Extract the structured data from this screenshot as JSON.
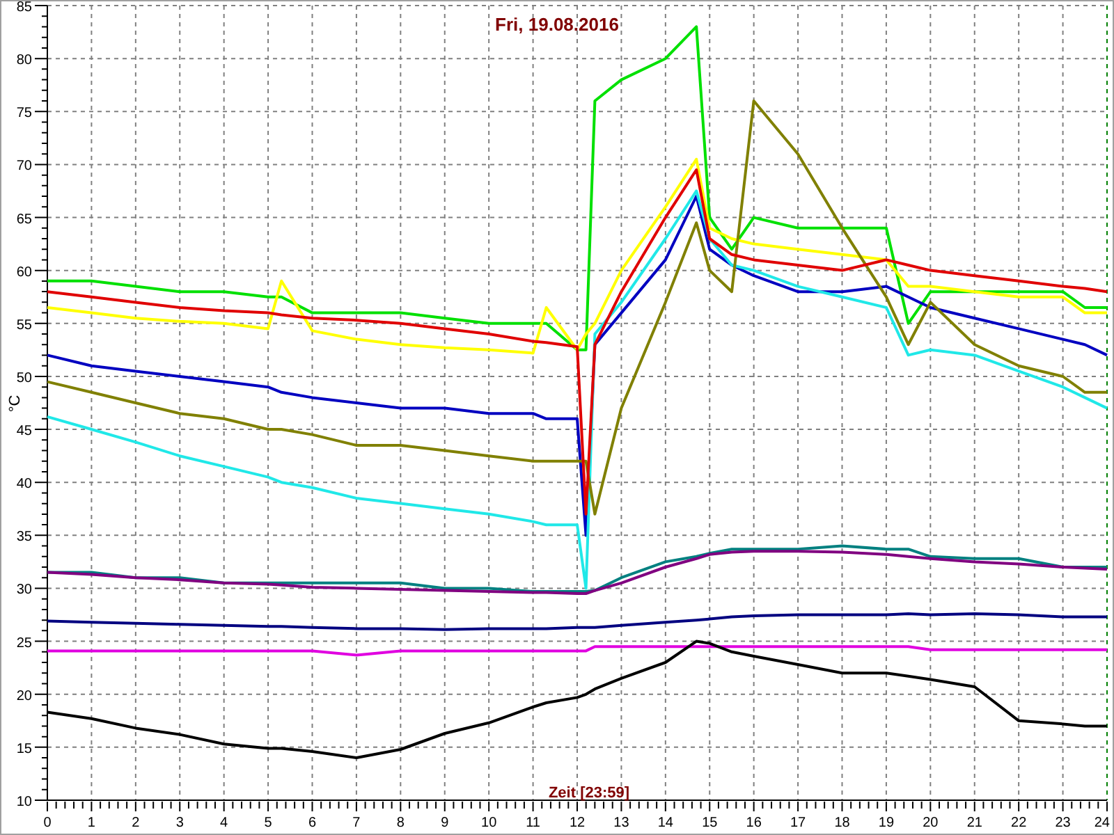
{
  "chart": {
    "chart_data": {
      "type": "line",
      "title": "Fri, 19.08.2016",
      "xlabel": "Zeit [23:59]",
      "ylabel": "°C",
      "x": [
        0,
        1,
        2,
        3,
        4,
        5,
        5.3,
        6,
        7,
        8,
        9,
        10,
        11,
        11.3,
        12,
        12.2,
        12.4,
        13,
        14,
        14.7,
        15,
        15.5,
        16,
        17,
        18,
        19,
        19.5,
        20,
        21,
        22,
        23,
        23.5,
        24
      ],
      "series": [
        {
          "color": "#00e000",
          "values": [
            59,
            59,
            58.5,
            58,
            58,
            57.5,
            57.5,
            56,
            56,
            56,
            55.5,
            55,
            55,
            55,
            52.5,
            52.5,
            76,
            78,
            80,
            83,
            65,
            62,
            65,
            64,
            64,
            64,
            55,
            58,
            58,
            58,
            58,
            56.5,
            56.5
          ]
        },
        {
          "color": "#ffff00",
          "values": [
            56.5,
            56,
            55.5,
            55.2,
            55,
            54.5,
            59,
            54.3,
            53.5,
            53,
            52.7,
            52.5,
            52.2,
            56.5,
            52.5,
            54,
            55,
            60,
            66,
            70.5,
            64,
            63,
            62.5,
            62,
            61.5,
            61,
            58.5,
            58.5,
            58,
            57.5,
            57.5,
            56,
            56
          ]
        },
        {
          "color": "#0000c0",
          "values": [
            52,
            51,
            50.5,
            50,
            49.5,
            49,
            48.5,
            48,
            47.5,
            47,
            47,
            46.5,
            46.5,
            46,
            46,
            35,
            53,
            56,
            61,
            67,
            62,
            60.5,
            59.5,
            58,
            58,
            58.5,
            57.5,
            56.5,
            55.5,
            54.5,
            53.5,
            53,
            52
          ]
        },
        {
          "color": "#20e8e8",
          "values": [
            46.2,
            45,
            43.8,
            42.5,
            41.5,
            40.5,
            40,
            39.5,
            38.5,
            38,
            37.5,
            37,
            36.3,
            36,
            36,
            30,
            54,
            57,
            63,
            67.5,
            63,
            60.5,
            60,
            58.5,
            57.5,
            56.5,
            52,
            52.5,
            52,
            50.5,
            49,
            48,
            47
          ]
        },
        {
          "color": "#808000",
          "values": [
            49.5,
            48.5,
            47.5,
            46.5,
            46,
            45,
            45,
            44.5,
            43.5,
            43.5,
            43,
            42.5,
            42,
            42,
            42,
            42,
            37,
            47,
            57,
            64.5,
            60,
            58,
            76,
            71,
            64,
            57.5,
            53,
            57,
            53,
            51,
            50,
            48.5,
            48.5
          ]
        },
        {
          "color": "#008080",
          "values": [
            31.5,
            31.5,
            31,
            31,
            30.5,
            30.5,
            30.5,
            30.5,
            30.5,
            30.5,
            30,
            30,
            29.7,
            29.7,
            29.7,
            29.7,
            29.8,
            31,
            32.5,
            33,
            33.3,
            33.7,
            33.7,
            33.7,
            34,
            33.7,
            33.7,
            33,
            32.8,
            32.8,
            32,
            32,
            32
          ]
        },
        {
          "color": "#800080",
          "values": [
            31.5,
            31.3,
            31,
            30.8,
            30.5,
            30.4,
            30.3,
            30.1,
            30,
            29.9,
            29.8,
            29.7,
            29.6,
            29.6,
            29.5,
            29.5,
            29.8,
            30.5,
            32,
            32.8,
            33.2,
            33.4,
            33.5,
            33.5,
            33.4,
            33.2,
            33,
            32.8,
            32.5,
            32.3,
            32,
            31.9,
            31.8
          ]
        },
        {
          "color": "#000080",
          "values": [
            26.9,
            26.8,
            26.7,
            26.6,
            26.5,
            26.4,
            26.4,
            26.3,
            26.2,
            26.2,
            26.1,
            26.2,
            26.2,
            26.2,
            26.3,
            26.3,
            26.3,
            26.5,
            26.8,
            27,
            27.1,
            27.3,
            27.4,
            27.5,
            27.5,
            27.5,
            27.6,
            27.5,
            27.6,
            27.5,
            27.3,
            27.3,
            27.3
          ]
        },
        {
          "color": "#e000e0",
          "values": [
            24.1,
            24.1,
            24.1,
            24.1,
            24.1,
            24.1,
            24.1,
            24.1,
            23.7,
            24.1,
            24.1,
            24.1,
            24.1,
            24.1,
            24.1,
            24.1,
            24.5,
            24.5,
            24.5,
            24.5,
            24.5,
            24.5,
            24.5,
            24.5,
            24.5,
            24.5,
            24.5,
            24.2,
            24.2,
            24.2,
            24.2,
            24.2,
            24.2
          ]
        },
        {
          "color": "#000000",
          "values": [
            18.3,
            17.7,
            16.8,
            16.2,
            15.3,
            14.9,
            14.9,
            14.6,
            14,
            14.8,
            16.3,
            17.3,
            18.8,
            19.2,
            19.7,
            20,
            20.5,
            21.5,
            23,
            25,
            24.8,
            24,
            23.6,
            22.8,
            22,
            22,
            21.7,
            21.4,
            20.7,
            17.5,
            17.2,
            17,
            17
          ]
        },
        {
          "color": "#e00000",
          "values": [
            58,
            57.5,
            57,
            56.5,
            56.2,
            56,
            55.8,
            55.5,
            55.3,
            55,
            54.5,
            54,
            53.3,
            53.2,
            52.8,
            37,
            53,
            58,
            65,
            69.5,
            63,
            61.5,
            61,
            60.5,
            60,
            61,
            60.5,
            60,
            59.5,
            59,
            58.5,
            58.3,
            58
          ]
        }
      ],
      "grid": true,
      "xlim": [
        0,
        24
      ],
      "ylim": [
        10,
        85
      ],
      "xticks": [
        0,
        1,
        2,
        3,
        4,
        5,
        6,
        7,
        8,
        9,
        10,
        11,
        12,
        13,
        14,
        15,
        16,
        17,
        18,
        19,
        20,
        21,
        22,
        23,
        24
      ],
      "yticks": [
        10,
        15,
        20,
        25,
        30,
        35,
        40,
        45,
        50,
        55,
        60,
        65,
        70,
        75,
        80,
        85
      ]
    }
  }
}
